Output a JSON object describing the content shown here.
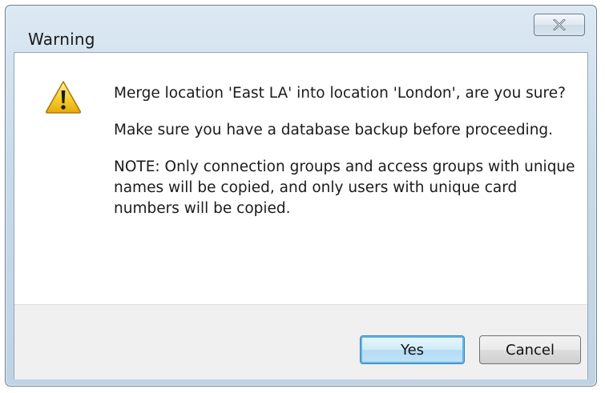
{
  "window": {
    "title": "Warning",
    "close_icon": "close-icon"
  },
  "dialog": {
    "icon": "warning-icon",
    "messages": [
      "Merge location 'East LA' into location 'London', are you sure?",
      "Make sure you have a database backup before proceeding.",
      "NOTE: Only connection groups and access groups with unique names will be copied, and only users with unique card numbers will be copied."
    ]
  },
  "buttons": {
    "yes_label": "Yes",
    "cancel_label": "Cancel"
  },
  "colors": {
    "accent": "#3c7fb1",
    "warning": "#f3c316"
  }
}
